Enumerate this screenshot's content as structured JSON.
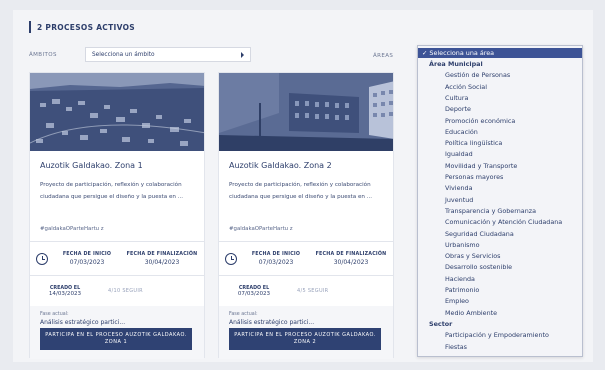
{
  "section": {
    "title": "2 PROCESOS ACTIVOS"
  },
  "filters": {
    "ambitos_label": "ÁMBITOS",
    "ambitos_value": "Selecciona un ámbito",
    "areas_label": "ÁREAS"
  },
  "cards": [
    {
      "title": "Auzotik Galdakao. Zona 1",
      "description": "Proyecto de participación, reflexión y colaboración ciudadana que persigue el diseño y la puesta en ...",
      "hashtag": "#galdakaOParteHartu z",
      "start_label": "FECHA DE INICIO",
      "start_date": "07/03/2023",
      "end_label": "FECHA DE FINALIZACIÓN",
      "end_date": "30/04/2023",
      "created_label": "CREADO EL",
      "created_date": "14/03/2023",
      "stat_text": "4/10   SEGUIR",
      "phase_label": "Fase actual:",
      "phase_value": "Análisis estratégico partici...",
      "cta_label": "PARTICIPA EN EL PROCESO AUZOTIK GALDAKAO. ZONA 1"
    },
    {
      "title": "Auzotik Galdakao. Zona 2",
      "description": "Proyecto de participación, reflexión y colaboración ciudadana que persigue el diseño y la puesta en ...",
      "hashtag": "#galdakaOParteHartu z",
      "start_label": "FECHA DE INICIO",
      "start_date": "07/03/2023",
      "end_label": "FECHA DE FINALIZACIÓN",
      "end_date": "30/04/2023",
      "created_label": "CREADO EL",
      "created_date": "07/03/2023",
      "stat_text": "4/5   SEGUIR",
      "phase_label": "Fase actual:",
      "phase_value": "Análisis estratégico partici...",
      "cta_label": "PARTICIPA EN EL PROCESO AUZOTIK GALDAKAO. ZONA 2"
    }
  ],
  "dropdown": {
    "selected": "✓ Selecciona una área",
    "options": [
      {
        "label": "Área Municipal",
        "kind": "group"
      },
      {
        "label": "Gestión de Personas",
        "kind": "child"
      },
      {
        "label": "Acción Social",
        "kind": "child"
      },
      {
        "label": "Cultura",
        "kind": "child"
      },
      {
        "label": "Deporte",
        "kind": "child"
      },
      {
        "label": "Promoción económica",
        "kind": "child"
      },
      {
        "label": "Educación",
        "kind": "child"
      },
      {
        "label": "Política lingüística",
        "kind": "child"
      },
      {
        "label": "Igualdad",
        "kind": "child"
      },
      {
        "label": "Movilidad y Transporte",
        "kind": "child"
      },
      {
        "label": "Personas mayores",
        "kind": "child"
      },
      {
        "label": "Vivienda",
        "kind": "child"
      },
      {
        "label": "Juventud",
        "kind": "child"
      },
      {
        "label": "Transparencia y Gobernanza",
        "kind": "child"
      },
      {
        "label": "Comunicación y Atención Ciudadana",
        "kind": "child"
      },
      {
        "label": "Seguridad Ciudadana",
        "kind": "child"
      },
      {
        "label": "Urbanismo",
        "kind": "child"
      },
      {
        "label": "Obras y Servicios",
        "kind": "child"
      },
      {
        "label": "Desarrollo sostenible",
        "kind": "child"
      },
      {
        "label": "Hacienda",
        "kind": "child"
      },
      {
        "label": "Patrimonio",
        "kind": "child"
      },
      {
        "label": "Empleo",
        "kind": "child"
      },
      {
        "label": "Medio Ambiente",
        "kind": "child"
      },
      {
        "label": "Sector",
        "kind": "group"
      },
      {
        "label": "Participación y Empoderamiento",
        "kind": "child"
      },
      {
        "label": "Fiestas",
        "kind": "child"
      }
    ]
  },
  "colors": {
    "accent": "#2f4273",
    "selected_option": "#3d5396",
    "page_bg": "#e9ebf0"
  }
}
